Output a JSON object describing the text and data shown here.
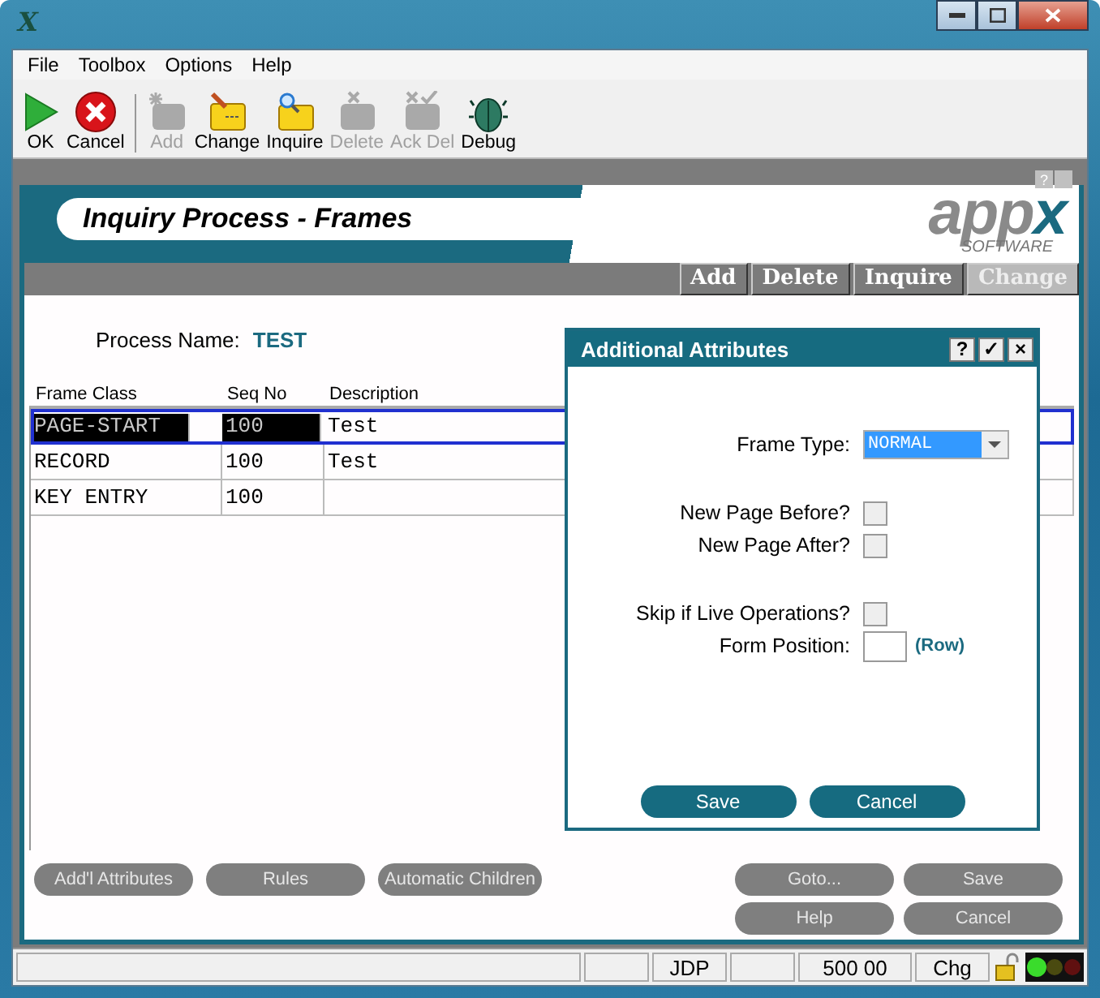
{
  "window": {
    "title_icon": "X"
  },
  "menu": [
    "File",
    "Toolbox",
    "Options",
    "Help"
  ],
  "toolbar": [
    {
      "label": "OK",
      "kind": "ok",
      "disabled": false
    },
    {
      "label": "Cancel",
      "kind": "cancel",
      "disabled": false
    },
    {
      "label": "Add",
      "kind": "add",
      "disabled": true
    },
    {
      "label": "Change",
      "kind": "change",
      "disabled": false
    },
    {
      "label": "Inquire",
      "kind": "inquire",
      "disabled": false
    },
    {
      "label": "Delete",
      "kind": "delete",
      "disabled": true
    },
    {
      "label": "Ack Del",
      "kind": "ackdel",
      "disabled": true
    },
    {
      "label": "Debug",
      "kind": "debug",
      "disabled": false
    }
  ],
  "header": {
    "title": "Inquiry Process - Frames",
    "help_button": "?",
    "logo": {
      "word": "app",
      "mark": "x",
      "subtitle": "SOFTWARE"
    },
    "tabs": [
      {
        "label": "Add",
        "selected": false
      },
      {
        "label": "Delete",
        "selected": false
      },
      {
        "label": "Inquire",
        "selected": false
      },
      {
        "label": "Change",
        "selected": true
      }
    ]
  },
  "process_name": {
    "label": "Process Name:",
    "value": "TEST"
  },
  "table": {
    "columns": [
      "Frame Class",
      "Seq No",
      "Description"
    ],
    "rows": [
      {
        "cells": [
          "PAGE-START",
          "100",
          "Test"
        ],
        "selected": true
      },
      {
        "cells": [
          "RECORD",
          "100",
          "Test"
        ],
        "selected": false
      },
      {
        "cells": [
          "KEY ENTRY",
          "100"
        ],
        "selected": false
      }
    ]
  },
  "buttons_left": [
    "Add'l Attributes",
    "Rules",
    "Automatic Children"
  ],
  "buttons_right": [
    "Goto...",
    "Save",
    "Help",
    "Cancel"
  ],
  "dialog": {
    "title": "Additional Attributes",
    "title_buttons": [
      "?",
      "✓",
      "×"
    ],
    "frame_type": {
      "label": "Frame Type:",
      "value": "NORMAL"
    },
    "check_groups": [
      [
        {
          "label": "New Page Before?",
          "checked": false
        },
        {
          "label": "New Page After?",
          "checked": false
        }
      ],
      [
        {
          "label": "Skip if Live Operations?",
          "checked": false
        }
      ]
    ],
    "form_position": {
      "label": "Form Position:",
      "hint": "(Row)"
    },
    "buttons": [
      "Save",
      "Cancel"
    ]
  },
  "status_bar": [
    {
      "kind": "blank"
    },
    {
      "kind": "text",
      "text": "JDP"
    },
    {
      "kind": "blank"
    },
    {
      "kind": "text",
      "text": "500 00"
    },
    {
      "kind": "text",
      "text": "Chg"
    }
  ]
}
